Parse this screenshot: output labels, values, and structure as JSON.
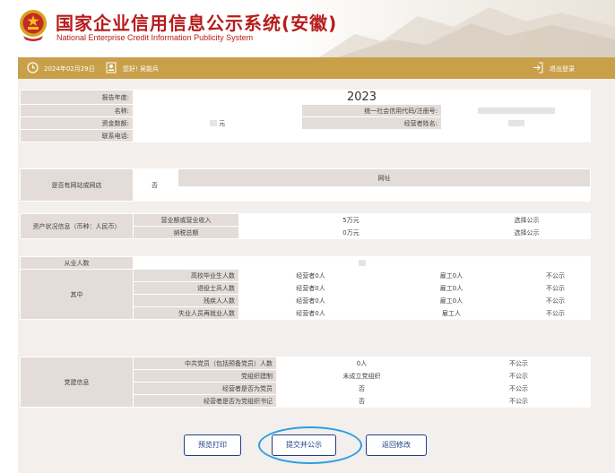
{
  "header": {
    "title": "国家企业信用信息公示系统(安徽)",
    "subtitle": "National Enterprise Credit Information Publicity System"
  },
  "topbar": {
    "date": "2024年02月29日",
    "greeting": "您好!  吴能兵",
    "logout": "退出登录"
  },
  "basic": {
    "year_label": "报告年度:",
    "year_value": "2023",
    "name_label": "名称:",
    "credit_code_label": "统一社会信用代码/注册号:",
    "capital_label": "资金数额:",
    "capital_unit": "元",
    "operator_label": "经营者姓名:",
    "phone_label": "联系电话:"
  },
  "website": {
    "label": "是否有网站或网店",
    "value": "否",
    "url_header": "网址"
  },
  "assets": {
    "label": "资产状况信息（币种：人民币）",
    "rows": [
      {
        "name": "营业额或营业收入",
        "value": "5万元",
        "publicity": "选择公示"
      },
      {
        "name": "纳税总额",
        "value": "0万元",
        "publicity": "选择公示"
      }
    ]
  },
  "employees": {
    "label": "从业人数",
    "group_label": "其中",
    "rows": [
      {
        "name": "高校毕业生人数",
        "operator": "经营者0人",
        "hired": "雇工0人",
        "publicity": "不公示"
      },
      {
        "name": "退役士兵人数",
        "operator": "经营者0人",
        "hired": "雇工0人",
        "publicity": "不公示"
      },
      {
        "name": "残疾人人数",
        "operator": "经营者0人",
        "hired": "雇工0人",
        "publicity": "不公示"
      },
      {
        "name": "失业人员再就业人数",
        "operator": "经营者0人",
        "hired": "雇工人",
        "publicity": "不公示"
      }
    ]
  },
  "party": {
    "label": "党建信息",
    "rows": [
      {
        "name": "中共党员（包括预备党员）人数",
        "value": "0人",
        "publicity": "不公示"
      },
      {
        "name": "党组织建制",
        "value": "未成立党组织",
        "publicity": "不公示"
      },
      {
        "name": "经营者是否为党员",
        "value": "否",
        "publicity": "不公示"
      },
      {
        "name": "经营者是否为党组织书记",
        "value": "否",
        "publicity": "不公示"
      }
    ]
  },
  "buttons": {
    "preview": "预览打印",
    "submit": "提交并公示",
    "back": "返回修改"
  },
  "colors": {
    "title_red": "#b71c1c",
    "bar_gold": "#c9a049",
    "highlight_blue": "#29a0e0"
  }
}
